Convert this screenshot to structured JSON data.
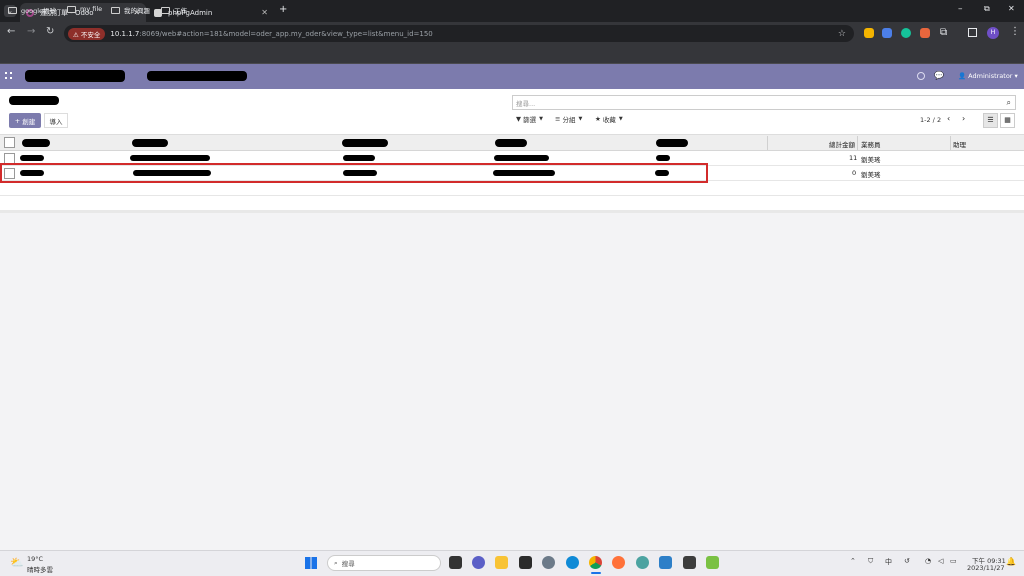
{
  "browser": {
    "tabs": [
      {
        "label": "蓮訪訂單 - Odoo",
        "active": true
      },
      {
        "label": "phpPgAdmin",
        "active": false
      }
    ],
    "new_tab": "+",
    "security_badge": "不安全",
    "url_host": "10.1.1.7",
    "url_rest": ":8069/web#action=181&model=oder_app.my_oder&view_type=list&menu_id=150",
    "bookmarks": [
      "google帳號",
      "my file",
      "我的興趣",
      "工作"
    ],
    "profile_initial": "H"
  },
  "odoo": {
    "user": "Administrator",
    "create_label": "創建",
    "import_label": "導入",
    "search_placeholder": "搜尋...",
    "filters_label": "篩選",
    "group_label": "分組",
    "favorites_label": "收藏",
    "pager": "1-2 / 2",
    "columns": {
      "total": "總計金額",
      "salesperson": "業務員",
      "assistant": "助理"
    },
    "rows": [
      {
        "total": "11",
        "salesperson": "劉美瑤"
      },
      {
        "total": "0",
        "salesperson": "劉美瑤"
      }
    ]
  },
  "taskbar": {
    "weather_temp": "19°C",
    "weather_desc": "晴時多雲",
    "search_label": "搜尋",
    "ime": "中",
    "time": "下午 09:31",
    "date": "2023/11/27"
  }
}
